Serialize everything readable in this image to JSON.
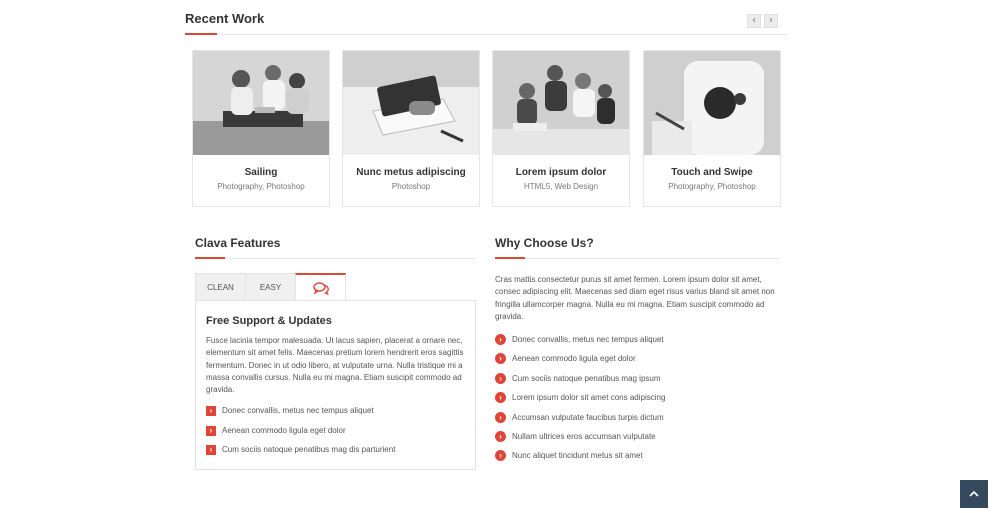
{
  "recent_work": {
    "title": "Recent Work",
    "prev_icon": "chevron-left-icon",
    "next_icon": "chevron-right-icon",
    "items": [
      {
        "title": "Sailing",
        "subtitle": "Photography, Photoshop"
      },
      {
        "title": "Nunc metus adipiscing",
        "subtitle": "Photoshop"
      },
      {
        "title": "Lorem ipsum dolor",
        "subtitle": "HTML5, Web Design"
      },
      {
        "title": "Touch and Swipe",
        "subtitle": "Photography, Photoshop"
      }
    ]
  },
  "features": {
    "title": "Clava Features",
    "tabs": [
      {
        "label": "CLEAN"
      },
      {
        "label": "EASY"
      },
      {
        "icon": "chat-bubbles-icon"
      }
    ],
    "panel_title": "Free Support & Updates",
    "panel_text": "Fusce lacinia tempor malesuada. Ut lacus sapien, placerat a ornare nec, elementum sit amet felis. Maecenas pretium lorem hendrerit eros sagittis fermentum. Donec in ut odio libero, at vulputate urna. Nulla tristique mi a massa convallis cursus. Nulla eu mi magna. Etiam suscipit commodo ad gravida.",
    "list": [
      "Donec convallis, metus nec tempus aliquet",
      "Aenean commodo ligula eget dolor",
      "Cum sociis natoque penatibus mag dis parturient"
    ]
  },
  "why": {
    "title": "Why Choose Us?",
    "text": "Cras mattis consectetur purus sit amet fermen. Lorem ipsum dolor sit amet, consec adipiscing elit. Maecenas sed diam eget risus varius bland sit amet non fringilla ullamcorper magna. Nulla eu mi magna. Etiam suscipit commodo ad gravida.",
    "list": [
      "Donec convallis, metus nec tempus aliquet",
      "Aenean commodo ligula eget dolor",
      "Cum sociis natoque penatibus mag ipsum",
      "Lorem ipsum dolor sit amet cons adipiscing",
      "Accumsan vulputate faucibus turpis dictum",
      "Nullam ultrices eros accumsan vulputate",
      "Nunc aliquet tincidunt metus sit amet"
    ]
  },
  "colors": {
    "accent": "#e0453a",
    "to_top_bg": "#34495e"
  },
  "to_top_icon": "chevron-up-icon"
}
